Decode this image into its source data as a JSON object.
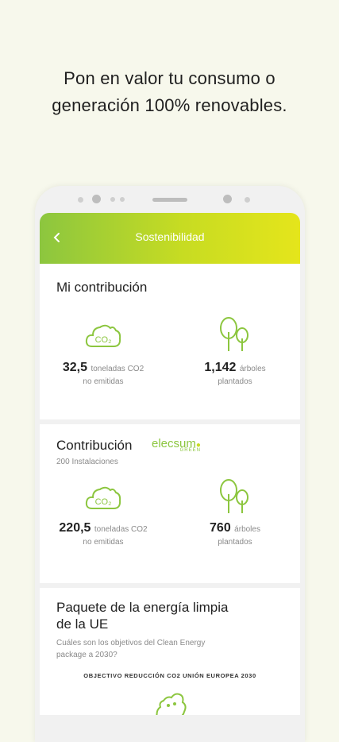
{
  "promo": {
    "line1": "Pon en valor tu consumo o",
    "line2": "generación 100% renovables."
  },
  "app": {
    "title": "Sostenibilidad",
    "accent": "#8cc63f"
  },
  "mi_contribucion": {
    "title": "Mi contribución",
    "co2": {
      "value": "32,5",
      "unit": "toneladas CO2",
      "line2": "no emitidas",
      "icon_label": "CO₂"
    },
    "trees": {
      "value": "1,142",
      "unit": "árboles",
      "line2": "plantados"
    }
  },
  "contribucion": {
    "title": "Contribución",
    "brand": "elecsum",
    "brand_sub": "GREEN",
    "installations": "200 Instalaciones",
    "co2": {
      "value": "220,5",
      "unit": "toneladas CO2",
      "line2": "no emitidas",
      "icon_label": "CO₂"
    },
    "trees": {
      "value": "760",
      "unit": "árboles",
      "line2": "plantados"
    }
  },
  "paquete": {
    "title_line1": "Paquete de la energía limpia",
    "title_line2": "de la UE",
    "subtitle_line1": "Cuáles son los objetivos del Clean Energy",
    "subtitle_line2": "package a 2030?",
    "objective": "OBJECTIVO REDUCCIÓN CO2 UNIÓN EUROPEA 2030"
  }
}
